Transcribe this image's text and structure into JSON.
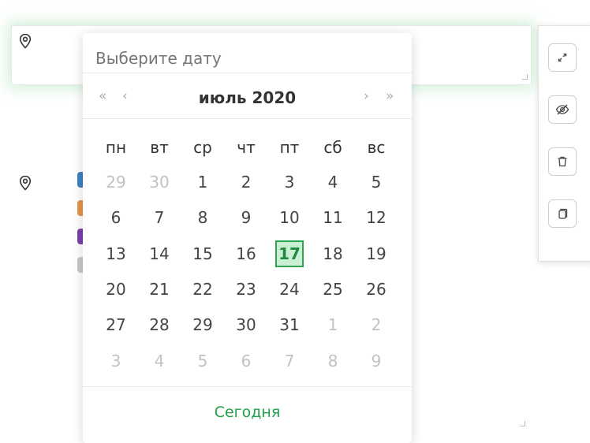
{
  "datepicker": {
    "placeholder": "Выберите дату",
    "month_title": "июль 2020",
    "prev_year_label": "«",
    "prev_month_label": "‹",
    "next_month_label": "›",
    "next_year_label": "»",
    "weekdays": [
      "пн",
      "вт",
      "ср",
      "чт",
      "пт",
      "сб",
      "вс"
    ],
    "weeks": [
      [
        {
          "d": "29",
          "m": true
        },
        {
          "d": "30",
          "m": true
        },
        {
          "d": "1"
        },
        {
          "d": "2"
        },
        {
          "d": "3"
        },
        {
          "d": "4"
        },
        {
          "d": "5"
        }
      ],
      [
        {
          "d": "6"
        },
        {
          "d": "7"
        },
        {
          "d": "8"
        },
        {
          "d": "9"
        },
        {
          "d": "10"
        },
        {
          "d": "11"
        },
        {
          "d": "12"
        }
      ],
      [
        {
          "d": "13"
        },
        {
          "d": "14"
        },
        {
          "d": "15"
        },
        {
          "d": "16"
        },
        {
          "d": "17",
          "sel": true
        },
        {
          "d": "18"
        },
        {
          "d": "19"
        }
      ],
      [
        {
          "d": "20"
        },
        {
          "d": "21"
        },
        {
          "d": "22"
        },
        {
          "d": "23"
        },
        {
          "d": "24"
        },
        {
          "d": "25"
        },
        {
          "d": "26"
        }
      ],
      [
        {
          "d": "27"
        },
        {
          "d": "28"
        },
        {
          "d": "29"
        },
        {
          "d": "30"
        },
        {
          "d": "31"
        },
        {
          "d": "1",
          "m": true
        },
        {
          "d": "2",
          "m": true
        }
      ],
      [
        {
          "d": "3",
          "m": true
        },
        {
          "d": "4",
          "m": true
        },
        {
          "d": "5",
          "m": true
        },
        {
          "d": "6",
          "m": true
        },
        {
          "d": "7",
          "m": true
        },
        {
          "d": "8",
          "m": true
        },
        {
          "d": "9",
          "m": true
        }
      ]
    ],
    "today_label": "Сегодня"
  },
  "toolbar": {
    "icons": [
      "expand-icon",
      "hide-icon",
      "trash-icon",
      "copy-icon"
    ]
  },
  "colors": {
    "accent": "#22a04a",
    "selected_bg": "#c9efd4",
    "chip_colors": [
      "#3b82c4",
      "#e8934a",
      "#7a3fb0",
      "#c8c8c8"
    ]
  }
}
